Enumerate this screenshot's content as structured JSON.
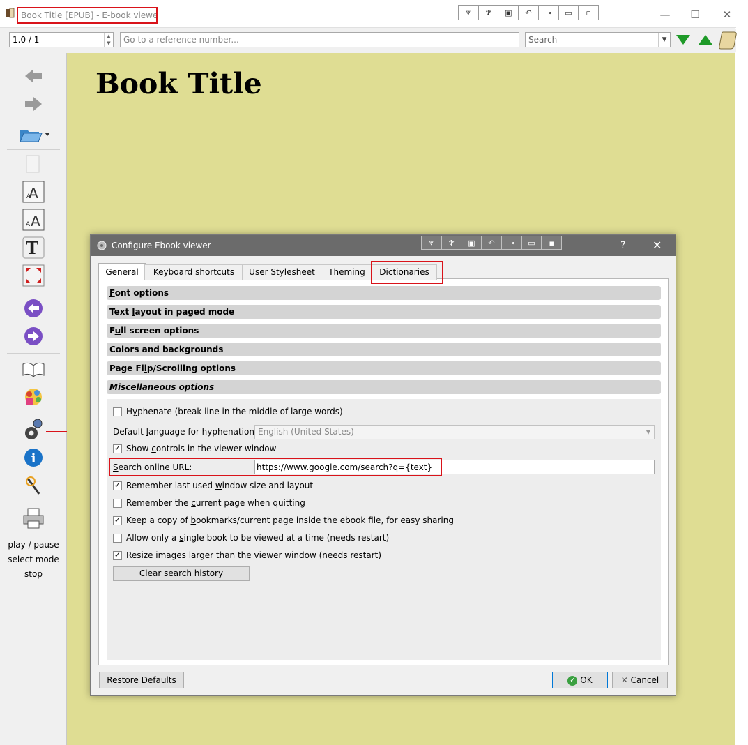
{
  "window": {
    "title": "Book Title [EPUB] - E-book viewer",
    "controls": {
      "minimize": "—",
      "maximize": "☐",
      "close": "✕"
    }
  },
  "toolbar": {
    "position_value": "1.0 / 1",
    "reference_placeholder": "Go to a reference number...",
    "search_placeholder": "Search"
  },
  "sidebar": {
    "icons": [
      "back-arrow-icon",
      "forward-arrow-icon",
      "open-folder-icon",
      "copy-icon",
      "font-larger-icon",
      "font-smaller-icon",
      "text-icon",
      "fullscreen-icon",
      "previous-page-icon",
      "next-page-icon",
      "table-of-contents-icon",
      "metadata-icon",
      "preferences-gear-icon",
      "info-icon",
      "magic-wand-icon",
      "print-icon"
    ],
    "text_items": [
      "play / pause",
      "select mode",
      "stop"
    ]
  },
  "book": {
    "heading": "Book Title"
  },
  "dialog": {
    "title": "Configure Ebook viewer",
    "help": "?",
    "close": "✕",
    "tabs": [
      {
        "pre": "",
        "key": "G",
        "post": "eneral",
        "active": true
      },
      {
        "pre": "",
        "key": "K",
        "post": "eyboard shortcuts",
        "active": false
      },
      {
        "pre": "",
        "key": "U",
        "post": "ser Stylesheet",
        "active": false
      },
      {
        "pre": "",
        "key": "T",
        "post": "heming",
        "active": false
      },
      {
        "pre": "",
        "key": "D",
        "post": "ictionaries",
        "active": false
      }
    ],
    "sections": [
      {
        "pre": "",
        "key": "F",
        "post": "ont options"
      },
      {
        "pre": "Text ",
        "key": "l",
        "post": "ayout in paged mode"
      },
      {
        "pre": "F",
        "key": "u",
        "post": "ll screen options"
      },
      {
        "pre": "Colors and backgrounds",
        "key": "",
        "post": ""
      },
      {
        "pre": "Page Fl",
        "key": "i",
        "post": "p/Scrolling options"
      },
      {
        "pre": "",
        "key": "M",
        "post": "iscellaneous options"
      }
    ],
    "misc": {
      "hyphenate": {
        "pre": "H",
        "key": "y",
        "post": "phenate (break line in the middle of large words)",
        "checked": false
      },
      "default_language_label": {
        "pre": "Default ",
        "key": "l",
        "post": "anguage for hyphenation:"
      },
      "default_language_value": "English (United States)",
      "show_controls": {
        "pre": "Show ",
        "key": "c",
        "post": "ontrols in the viewer window",
        "checked": true
      },
      "search_url_label": {
        "pre": "",
        "key": "S",
        "post": "earch online URL:"
      },
      "search_url_value": "https://www.google.com/search?q={text}",
      "remember_window": {
        "pre": "Remember last used ",
        "key": "w",
        "post": "indow size and layout",
        "checked": true
      },
      "remember_page": {
        "pre": "Remember the ",
        "key": "c",
        "post": "urrent page when quitting",
        "checked": false
      },
      "keep_bookmarks": {
        "pre": "Keep a copy of ",
        "key": "b",
        "post": "ookmarks/current page inside the ebook file, for easy sharing",
        "checked": true
      },
      "single_book": {
        "pre": "Allow only a ",
        "key": "s",
        "post": "ingle book to be viewed at a time (needs restart)",
        "checked": false
      },
      "resize_images": {
        "pre": "",
        "key": "R",
        "post": "esize images larger than the viewer window (needs restart)",
        "checked": true
      },
      "clear_history": "Clear search history"
    },
    "buttons": {
      "restore": "Restore Defaults",
      "ok": "OK",
      "cancel": "Cancel"
    }
  },
  "colors": {
    "annotation": "#d9131a",
    "book_background": "#dfdd93",
    "dialog_titlebar": "#6b6b6b"
  }
}
